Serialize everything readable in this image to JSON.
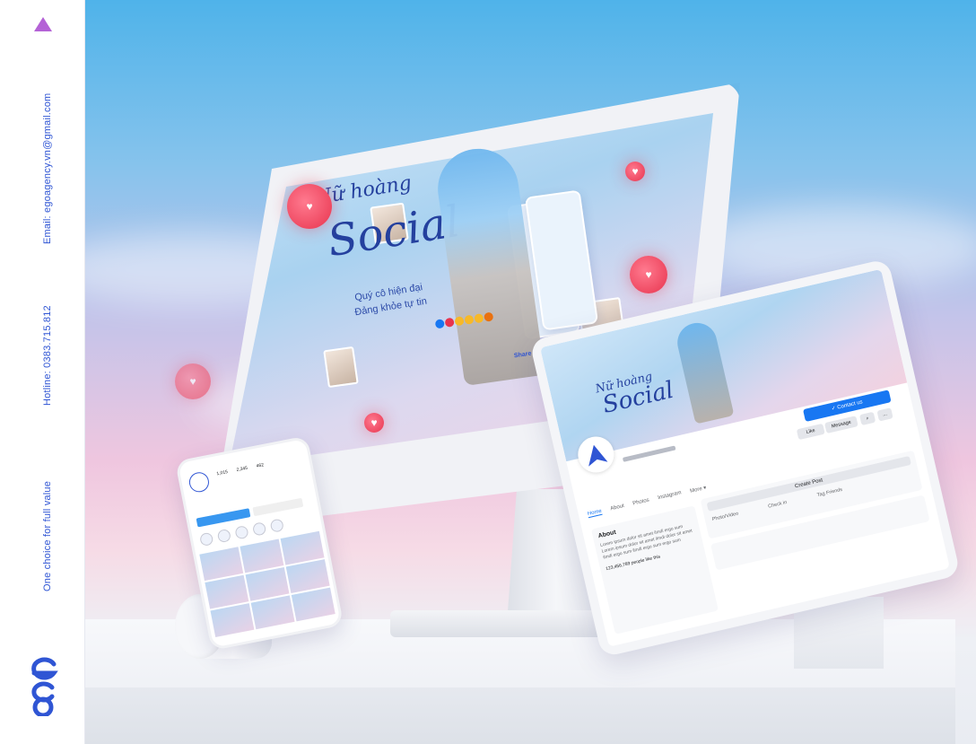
{
  "sidebar": {
    "email": "Email: egoagency.vn@gmail.com",
    "hotline": "Hotline: 0383.715.812",
    "tagline": "One choice for full value",
    "logo_text": "ego",
    "colors": {
      "accent": "#2f55d4",
      "brand_triangle": "#b462d6"
    }
  },
  "monitor_screen": {
    "title_line_1": "Nữ hoàng",
    "title_line_2": "Social",
    "subtitle_1": "Quý cô hiện đại",
    "subtitle_2": "Đảng khỏe tự tin",
    "share_label": "Share"
  },
  "tablet": {
    "mini_title_1": "Nữ hoàng",
    "mini_title_2": "Social",
    "contact_button": "✓ Contact us",
    "like_button": "Like",
    "message_button": "Message",
    "tabs": [
      "Home",
      "About",
      "Photos",
      "Instagram",
      "More ▾"
    ],
    "about_heading": "About",
    "about_text": "Lorem ipsum dolor sit amet ilmdi ergo sum Lorem ipsum dolor sit amet ilmdi dolor sit amet ilmdi ergo sum ilmdi ergo sum ergo sum",
    "likes_text": "123,456,789 people like this",
    "create_post": "Create Post",
    "post_options": [
      "Photo/Video",
      "Check in",
      "Tag Friends"
    ],
    "colors": {
      "facebook_blue": "#1877f2"
    }
  },
  "phone": {
    "stats": [
      "1,015",
      "2,345",
      "462"
    ],
    "colors": {
      "instagram_blue": "#3897f0"
    }
  }
}
